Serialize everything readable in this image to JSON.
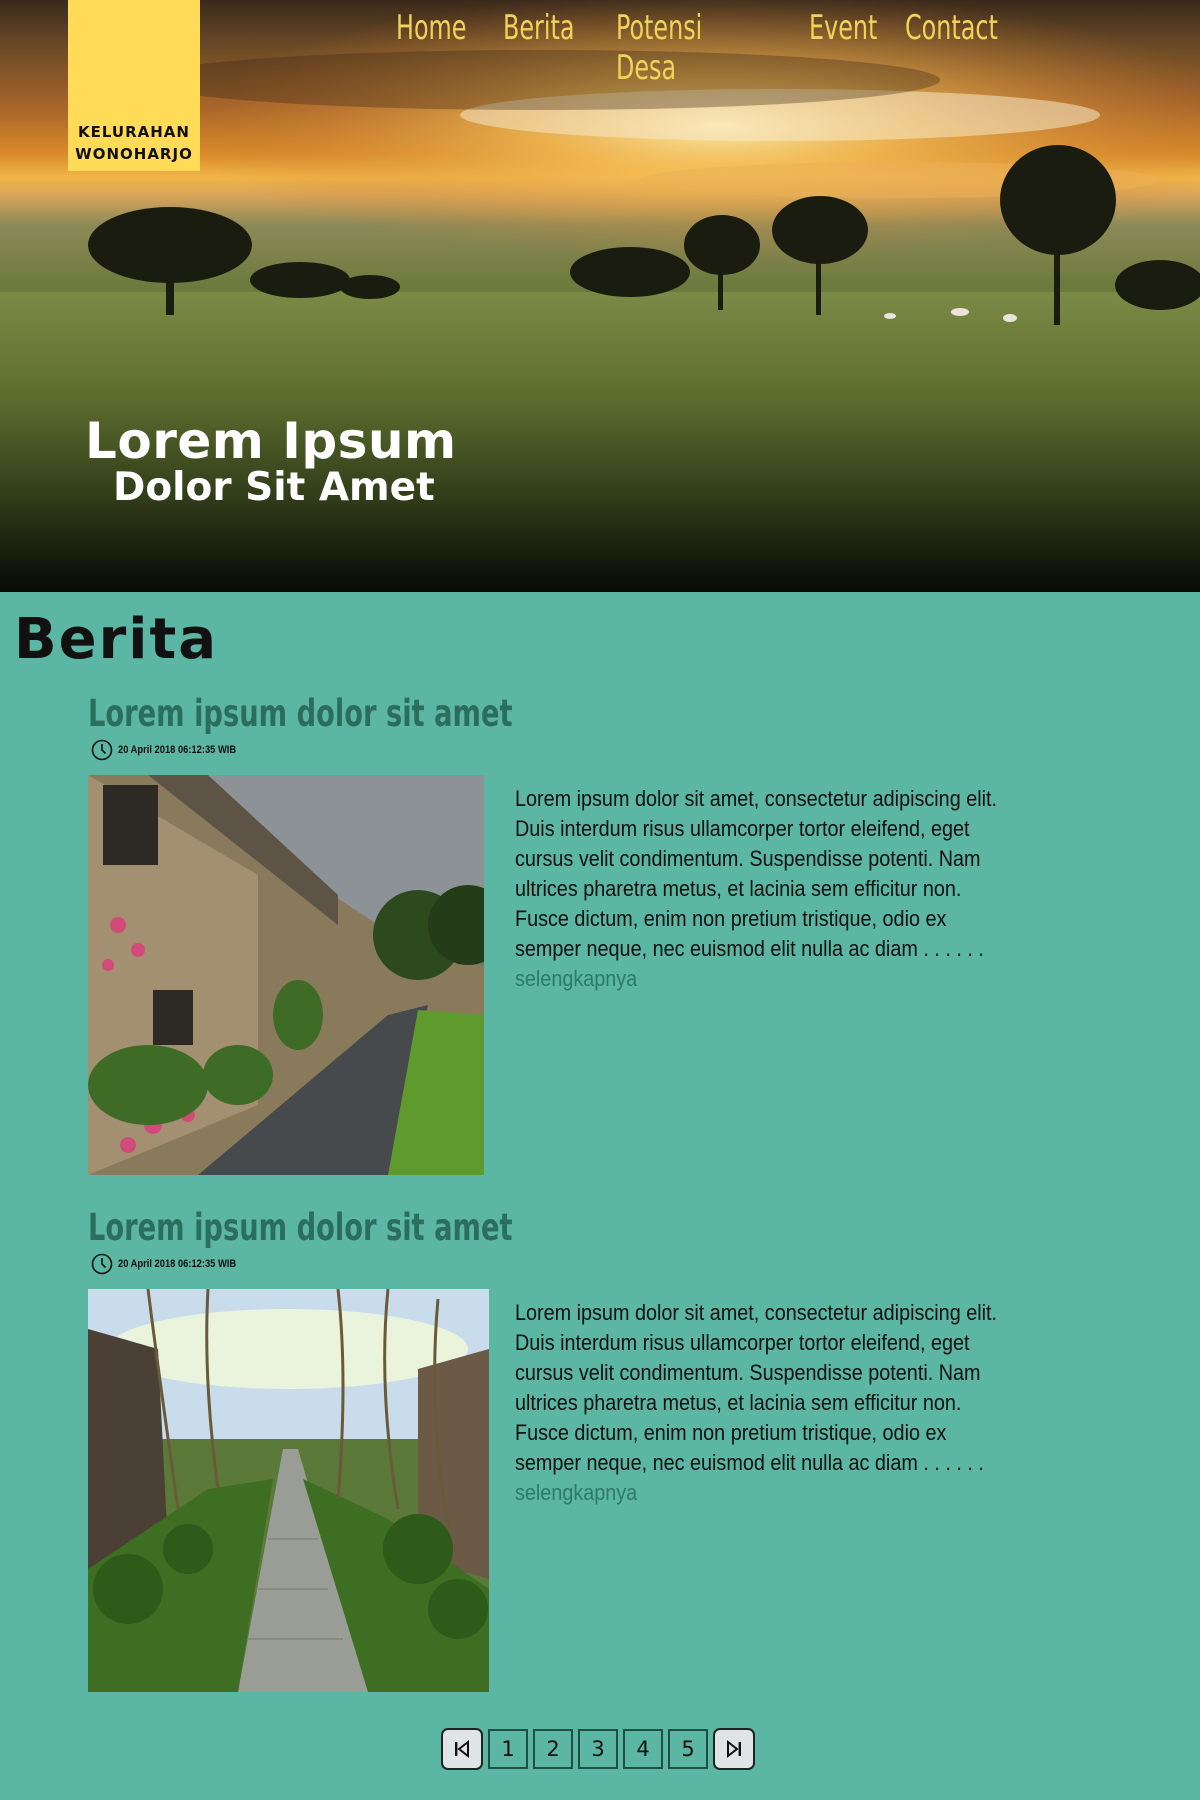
{
  "brand": {
    "line1": "KELURAHAN",
    "line2": "WONOHARJO"
  },
  "nav": {
    "items": [
      "Home",
      "Berita",
      "Potensi Desa",
      "Event",
      "Contact"
    ]
  },
  "hero": {
    "title": "Lorem Ipsum",
    "subtitle": "Dolor Sit Amet"
  },
  "section": {
    "title": "Berita"
  },
  "articles": [
    {
      "title": "Lorem ipsum dolor sit amet",
      "date": "20 April 2018 06:12:35 WIB",
      "excerpt": "Lorem ipsum dolor sit amet, consectetur adipiscing elit. Duis interdum risus ullamcorper tortor eleifend, eget cursus velit condimentum. Suspendisse potenti. Nam ultrices pharetra metus, et lacinia sem efficitur non. Fusce dictum, enim non pretium tristique, odio ex semper neque, nec euismod elit nulla ac diam . . . . . .",
      "more": "selengkapnya"
    },
    {
      "title": "Lorem ipsum dolor sit amet",
      "date": "20 April 2018 06:12:35 WIB",
      "excerpt": "Lorem ipsum dolor sit amet, consectetur adipiscing elit. Duis interdum risus ullamcorper tortor eleifend, eget cursus velit condimentum. Suspendisse potenti. Nam ultrices pharetra metus, et lacinia sem efficitur non. Fusce dictum, enim non pretium tristique, odio ex semper neque, nec euismod elit nulla ac diam . . . . . .",
      "more": "selengkapnya"
    }
  ],
  "pagination": {
    "pages": [
      "1",
      "2",
      "3",
      "4",
      "5"
    ],
    "first_icon": "skip-to-first-icon",
    "last_icon": "skip-to-last-icon"
  },
  "colors": {
    "background": "#5bb6a3",
    "logo": "#ffdb58",
    "nav": "#f2d25a",
    "article_title": "#2b6d5e",
    "link": "#2e7a68"
  }
}
